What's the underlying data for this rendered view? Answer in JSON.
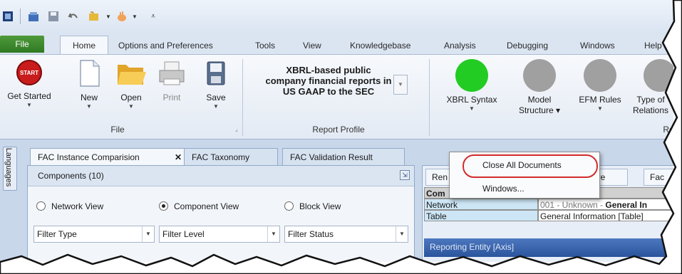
{
  "tabs": [
    "File",
    "Home",
    "Options and Preferences",
    "Tools",
    "View",
    "Knowledgebase",
    "Analysis",
    "Debugging",
    "Windows",
    "Help"
  ],
  "ribbon": {
    "get_started": "Get Started",
    "start_badge": "START",
    "new": "New",
    "open": "Open",
    "print": "Print",
    "save": "Save",
    "file_group": "File",
    "report_profile_text": "XBRL-based public company financial reports in US GAAP to the SEC",
    "report_profile_group": "Report Profile",
    "xbrl_syntax": "XBRL Syntax",
    "model_structure": "Model Structure",
    "efm_rules": "EFM Rules",
    "type_of_relations": "Type of Relations",
    "rep_group": "Re",
    "colors": {
      "green": "#22cc22",
      "gray": "#a0a0a0"
    }
  },
  "side": {
    "languages": "Languages"
  },
  "doc_tabs": [
    "FAC Instance Comparision",
    "FAC Taxonomy",
    "FAC Validation Result"
  ],
  "components": {
    "header": "Components (10)",
    "radios": [
      "Network View",
      "Component View",
      "Block View"
    ],
    "selected_radio": "Component View",
    "filters": [
      "Filter Type",
      "Filter Level",
      "Filter Status"
    ]
  },
  "right_panel": {
    "tabs": [
      "Ren",
      "ure",
      "Fac"
    ],
    "table_header": "Com",
    "rows": [
      {
        "label": "Network",
        "value_prefix": "001 - Unknown - ",
        "value_bold": "General In"
      },
      {
        "label": "Table",
        "value_prefix": "General Information [Table]",
        "value_bold": ""
      }
    ],
    "axis_label": "Reporting Entity [Axis]"
  },
  "context_menu": {
    "items": [
      "Close All Documents",
      "Windows..."
    ]
  }
}
